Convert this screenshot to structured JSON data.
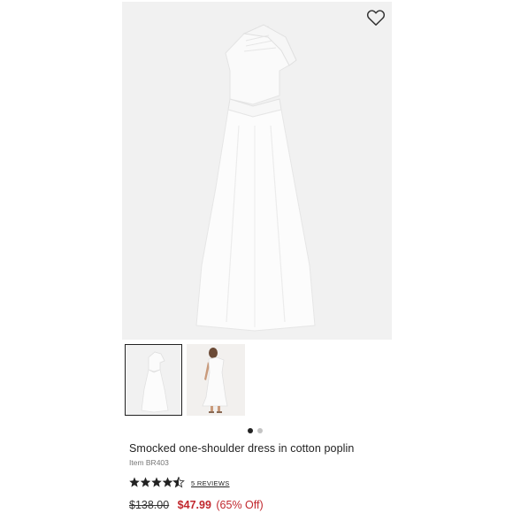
{
  "product": {
    "title": "Smocked one-shoulder dress in cotton poplin",
    "item_number": "Item BR403",
    "rating": 4.5,
    "rating_max": 5,
    "reviews_label": "5 REVIEWS",
    "price_original": "$138.00",
    "price_sale": "$47.99",
    "discount": "(65% Off)"
  },
  "gallery": {
    "thumbnails": [
      "flat-lay",
      "on-model"
    ],
    "active_index": 0,
    "page_count": 2
  },
  "icons": {
    "favorite": "heart-outline-icon",
    "rating": "star-icon"
  },
  "colors": {
    "sale_red": "#c1272d",
    "text": "#222222",
    "image_bg": "#f1f1f1"
  }
}
